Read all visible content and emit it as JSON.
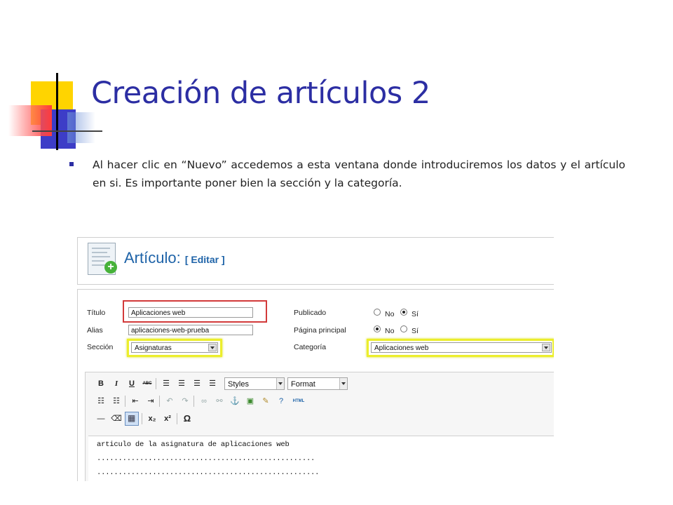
{
  "slide": {
    "title": "Creación de artículos 2",
    "bullet": "Al hacer clic en “Nuevo” accedemos a esta ventana donde introduciremos los datos y el artículo en si. Es importante poner bien la sección y la categoría."
  },
  "screenshot": {
    "header": {
      "title": "Artículo:",
      "subtitle": "[ Editar ]"
    },
    "form": {
      "title_label": "Título",
      "title_value": "Aplicaciones web",
      "alias_label": "Alias",
      "alias_value": "aplicaciones-web-prueba",
      "section_label": "Sección",
      "section_value": "Asignaturas",
      "published_label": "Publicado",
      "frontpage_label": "Página principal",
      "category_label": "Categoría",
      "category_value": "Aplicaciones web",
      "no_label": "No",
      "yes_label": "Sí",
      "published_selected": "Sí",
      "frontpage_selected": "No"
    },
    "toolbar": {
      "bold": "B",
      "italic": "I",
      "underline": "U",
      "strike": "ABC",
      "styles": "Styles",
      "format": "Format",
      "html": "HTML",
      "omega": "Ω",
      "subscript": "x₂",
      "superscript": "x²"
    },
    "editor_lines": [
      "articulo de la asignatura de aplicaciones web",
      "...................................................",
      "...................................................."
    ]
  },
  "colors": {
    "title": "#2c2ea3",
    "accent_blue": "#1e63a8",
    "highlight_red": "#d23a3a",
    "highlight_yellow": "#ecee2c"
  }
}
